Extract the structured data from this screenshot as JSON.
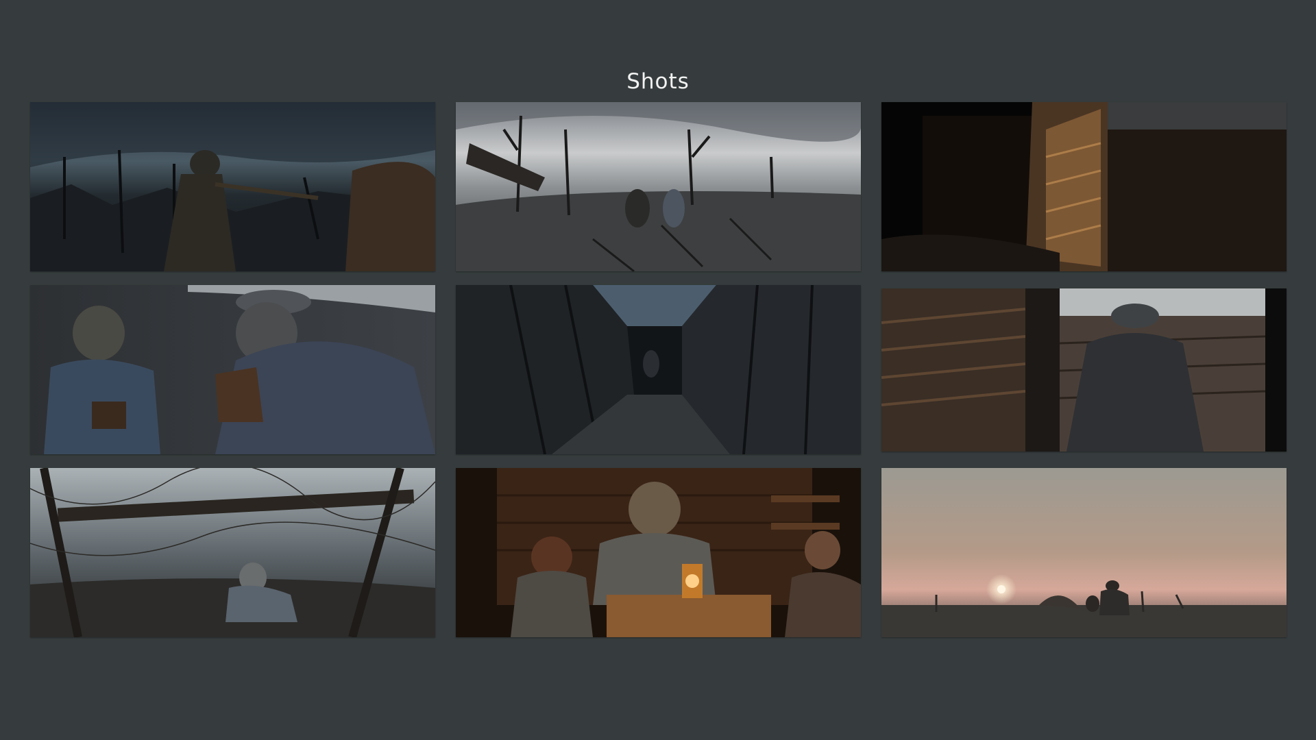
{
  "page": {
    "title": "Shots",
    "background_color": "#363c3d",
    "title_color": "#f2f2f2"
  },
  "gallery": {
    "shots": [
      {
        "scene": "soldier-aiming-rifle-barbed-wire-stormy-sky"
      },
      {
        "scene": "battlefield-dead-trees-barbed-wire-grey-sky"
      },
      {
        "scene": "dark-trench-wooden-planks-warm-light"
      },
      {
        "scene": "two-soldiers-talking-in-trench"
      },
      {
        "scene": "long-trench-corridor-soldier-far"
      },
      {
        "scene": "soldier-back-view-trench-doorway"
      },
      {
        "scene": "soldier-peeking-through-barbed-wire"
      },
      {
        "scene": "three-soldiers-lantern-dugout"
      },
      {
        "scene": "two-figures-sunset-wasteland"
      }
    ]
  }
}
